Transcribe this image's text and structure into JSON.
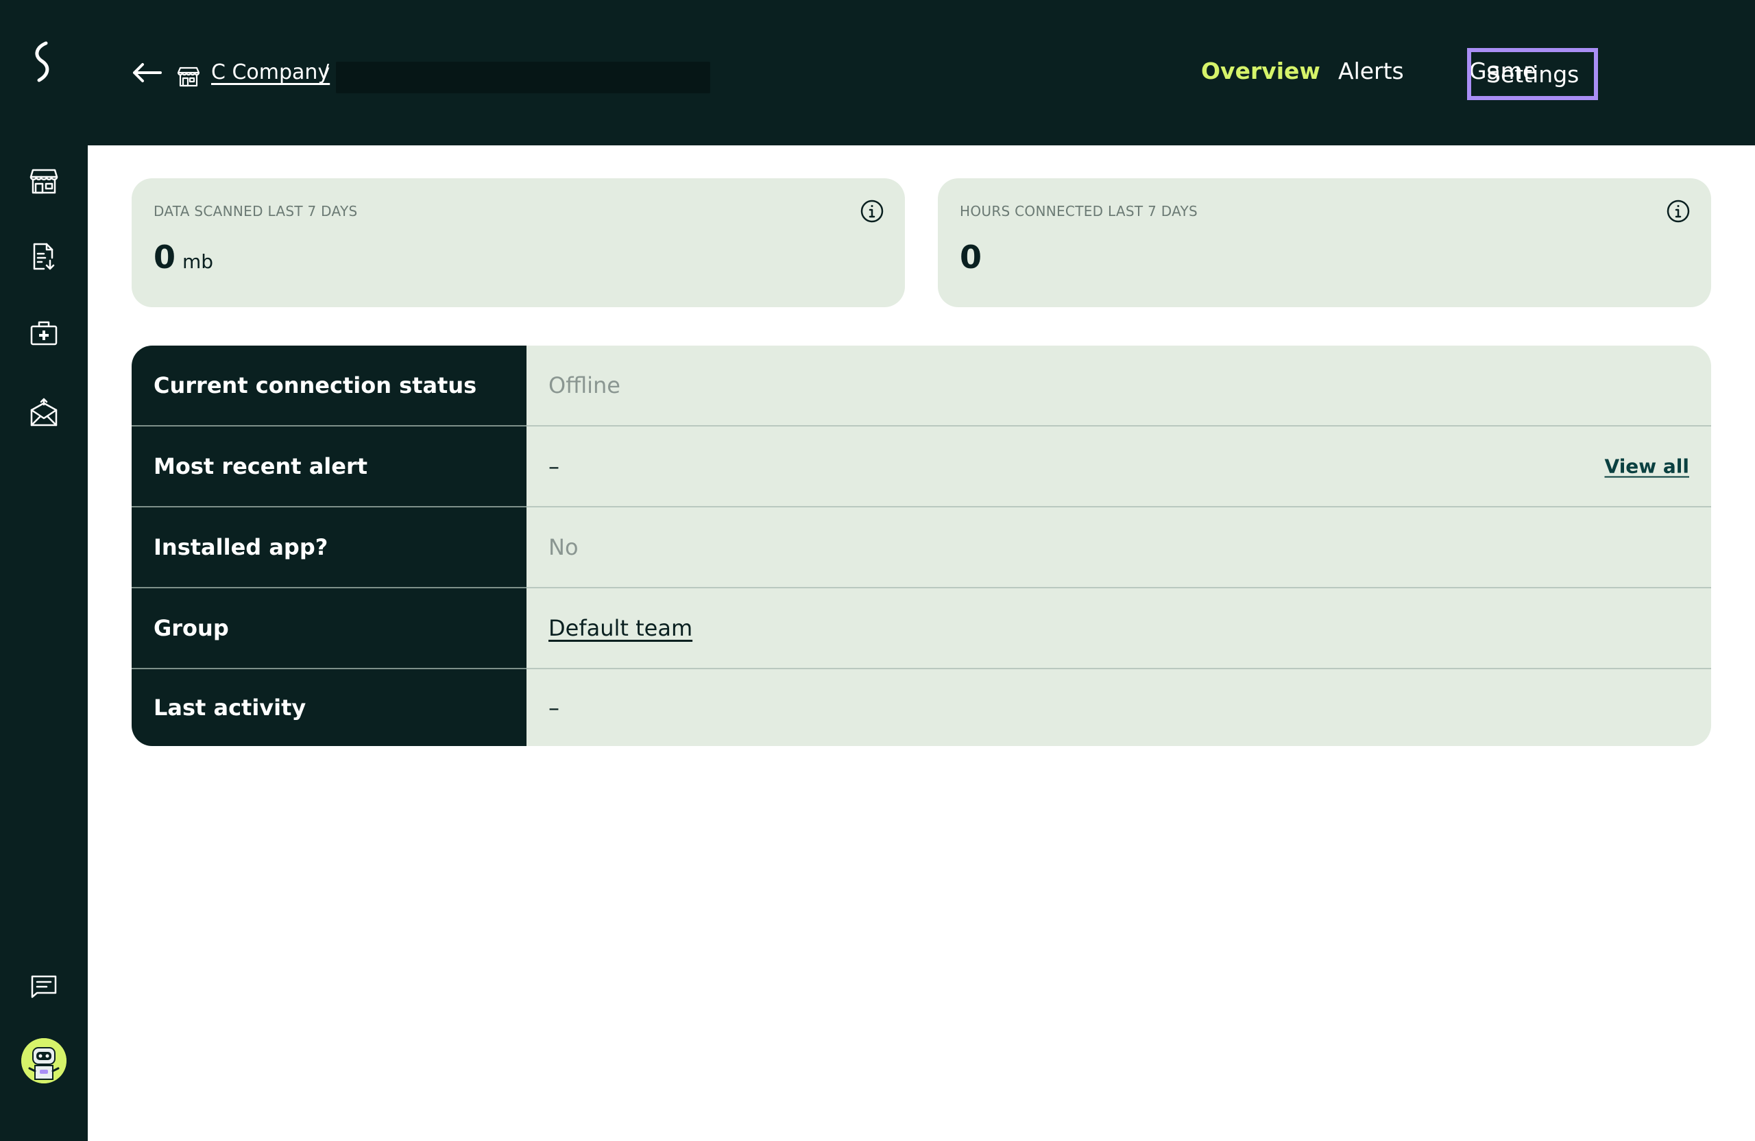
{
  "colors": {
    "dark": "#0a2020",
    "accent": "#d6f36a",
    "card_bg": "#e3ece1",
    "focus_outline": "#a98ef5"
  },
  "sidebar": {
    "logo": "brand-logo-icon",
    "items": [
      {
        "icon": "store-icon"
      },
      {
        "icon": "report-download-icon"
      },
      {
        "icon": "first-aid-icon"
      },
      {
        "icon": "mail-alert-icon"
      },
      {
        "icon": "chat-icon"
      }
    ],
    "avatar": "robot-avatar"
  },
  "header": {
    "breadcrumb": {
      "company": "C Company",
      "separator": "/"
    },
    "tabs": [
      {
        "label": "Overview",
        "active": true
      },
      {
        "label": "Alerts"
      },
      {
        "label": "Game"
      },
      {
        "label": "Settings",
        "focused": true
      }
    ]
  },
  "stats": {
    "data_scanned": {
      "label": "DATA SCANNED LAST 7 DAYS",
      "value": "0",
      "unit": "mb"
    },
    "hours_connected": {
      "label": "HOURS CONNECTED LAST 7 DAYS",
      "value": "0"
    }
  },
  "details": {
    "rows": [
      {
        "label": "Current connection status",
        "value": "Offline"
      },
      {
        "label": "Most recent alert",
        "value": "–",
        "action": "View all"
      },
      {
        "label": "Installed app?",
        "value": "No"
      },
      {
        "label": "Group",
        "value": "Default team"
      },
      {
        "label": "Last activity",
        "value": "–"
      }
    ]
  }
}
